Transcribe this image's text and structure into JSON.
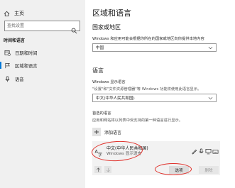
{
  "sidebar": {
    "home_label": "主页",
    "search_placeholder": "查找设置",
    "section_label": "时间和语言",
    "items": [
      {
        "label": "日期和时间",
        "icon": "calendar-clock-icon"
      },
      {
        "label": "区域和语言",
        "icon": "region-icon"
      },
      {
        "label": "语音",
        "icon": "microphone-icon"
      }
    ]
  },
  "main": {
    "title": "区域和语言",
    "country": {
      "heading": "国家或地区",
      "desc": "Windows 和应用可能会根据你所在的国家或地区向你提供本地内容",
      "value": "中国"
    },
    "language": {
      "heading": "语言",
      "display_label": "Windows 显示语言",
      "display_desc": "\"设置\"和\"文件资源管理器\"等 Windows 功能将使用此语言显示。",
      "display_value": "中文(中华人民共和国)",
      "preferred_label": "首选的语言",
      "preferred_desc": "应用和网站将以列表中受支持的第一种语言进行显示。",
      "add_label": "添加语言",
      "item": {
        "name": "中文(中华人民共和国)",
        "sub": "Windows 显示语言",
        "options_label": "选项",
        "remove_label": "删除"
      }
    }
  },
  "colors": {
    "accent": "#0078d7",
    "annotation": "#e0302a",
    "sidebar_bg": "#f0f0f0"
  }
}
